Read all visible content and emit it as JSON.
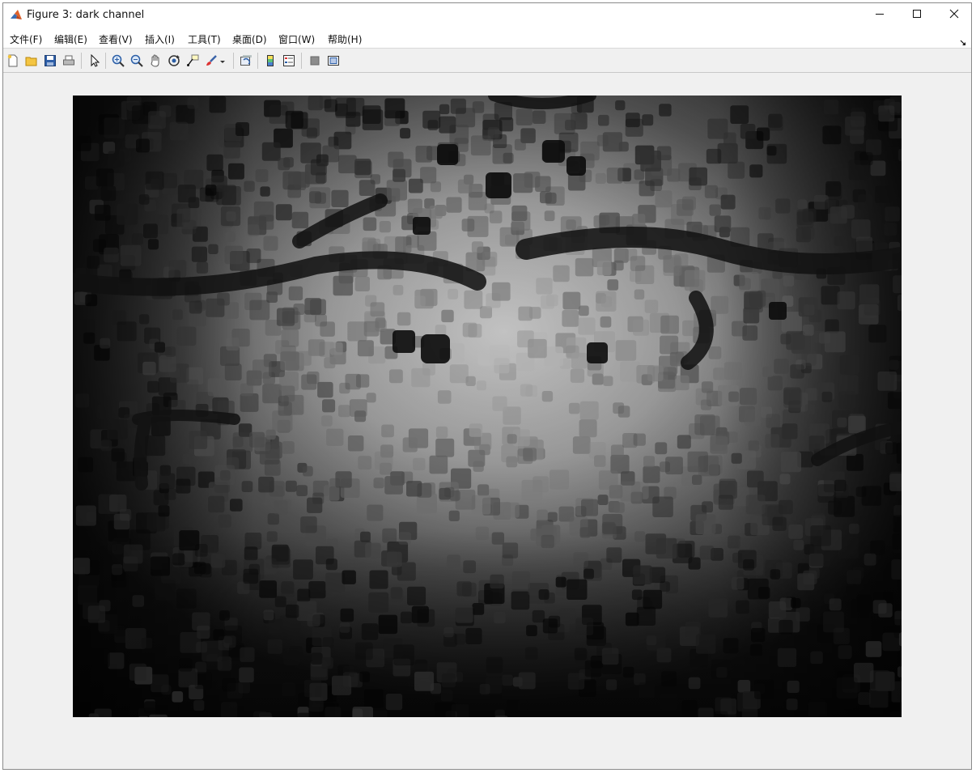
{
  "window": {
    "title": "Figure 3: dark channel",
    "controls": {
      "minimize_icon": "minimize-icon",
      "maximize_icon": "maximize-icon",
      "close_icon": "close-icon"
    }
  },
  "menu": {
    "items": [
      {
        "label": "文件(F)"
      },
      {
        "label": "编辑(E)"
      },
      {
        "label": "查看(V)"
      },
      {
        "label": "插入(I)"
      },
      {
        "label": "工具(T)"
      },
      {
        "label": "桌面(D)"
      },
      {
        "label": "窗口(W)"
      },
      {
        "label": "帮助(H)"
      }
    ]
  },
  "toolbar": {
    "tools": [
      "new-figure-icon",
      "open-file-icon",
      "save-icon",
      "print-icon",
      "pointer-icon",
      "zoom-in-icon",
      "zoom-out-icon",
      "pan-icon",
      "rotate-3d-icon",
      "data-cursor-icon",
      "brush-icon",
      "brush-dropdown-icon",
      "link-plot-icon",
      "colorbar-icon",
      "legend-icon",
      "hide-plot-tools-icon",
      "show-plot-tools-icon"
    ]
  },
  "figure": {
    "content": "grayscale image",
    "colors": {
      "background": "#f0f0f0",
      "image_dark": "#0e0e0e",
      "image_light": "#e4e4e4"
    }
  }
}
